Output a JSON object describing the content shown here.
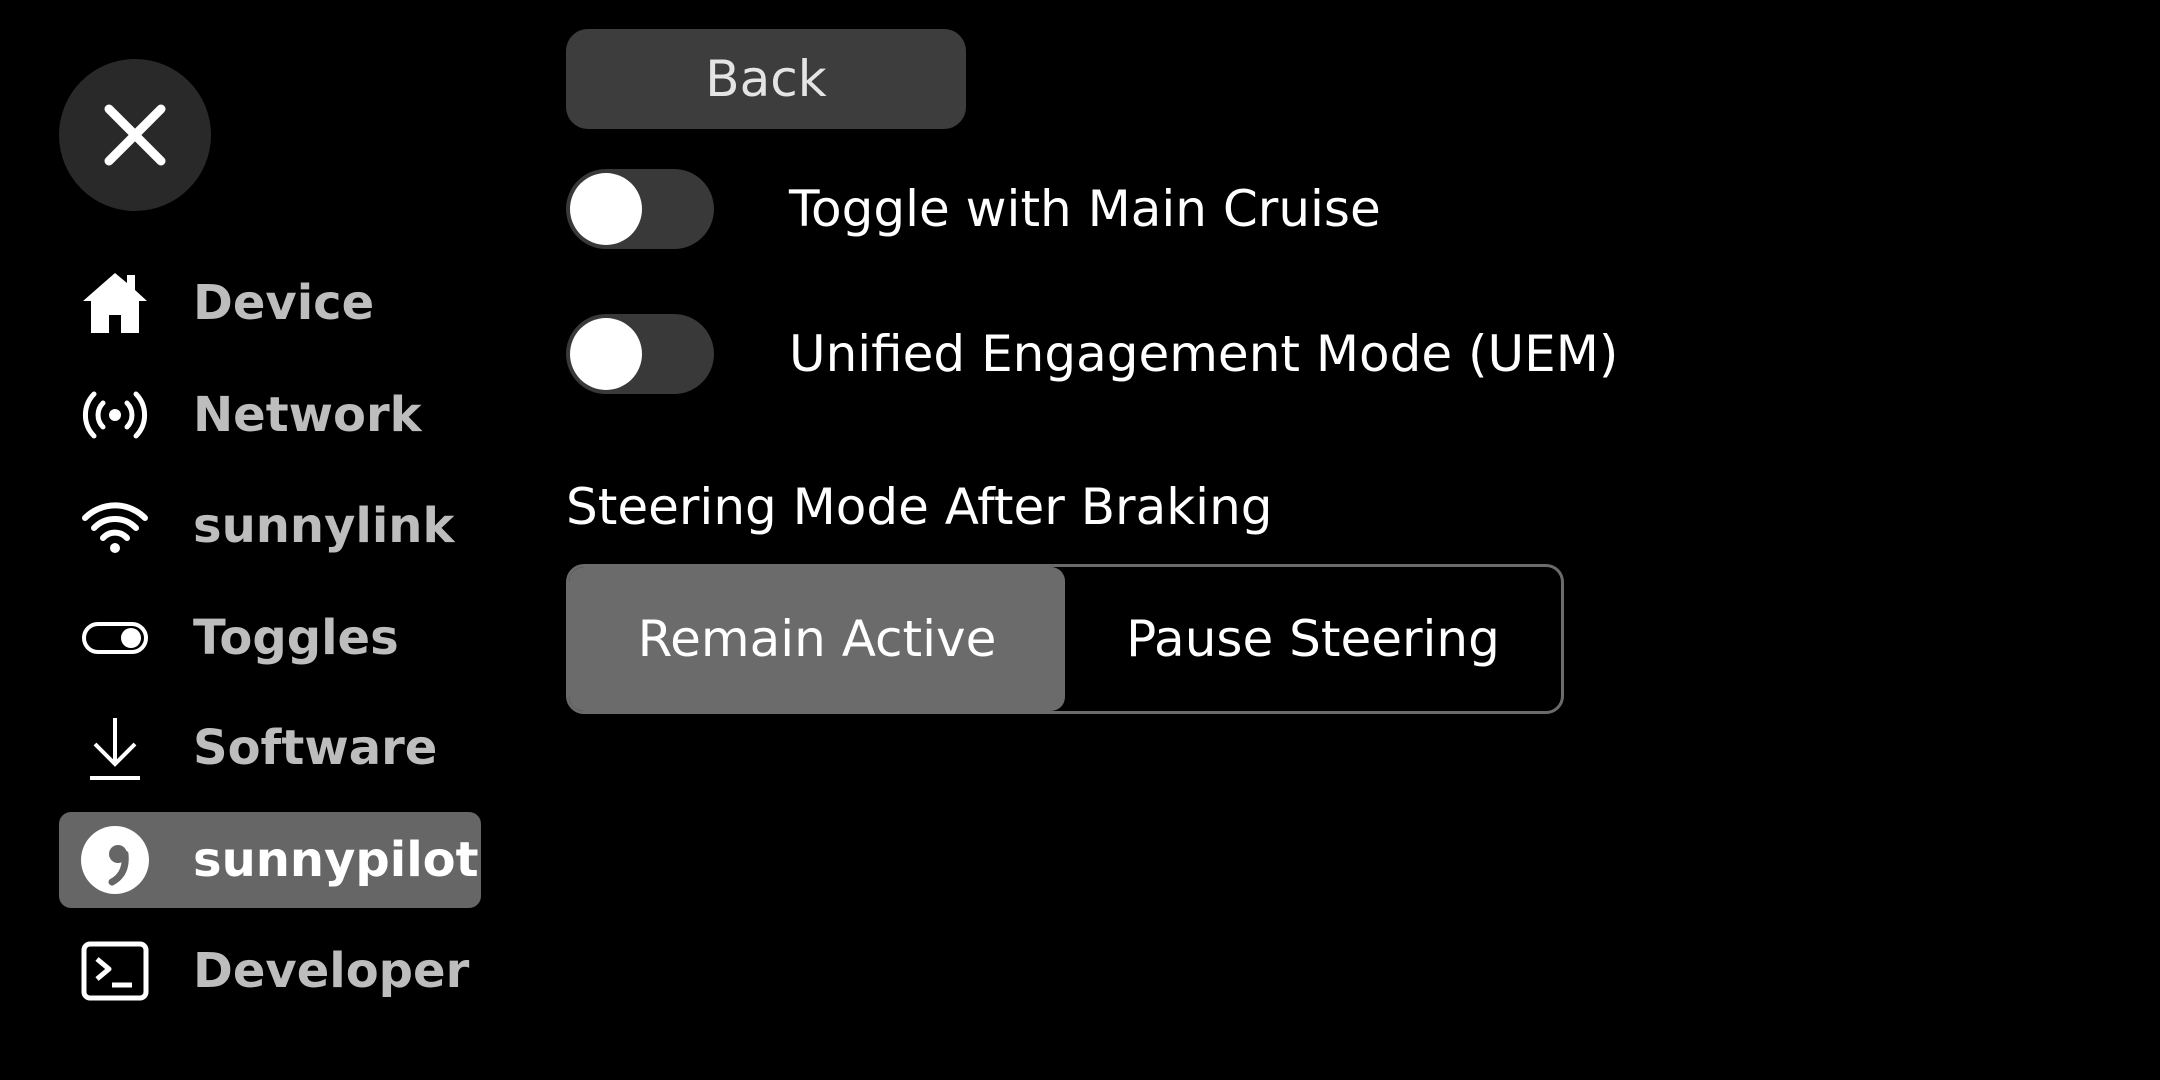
{
  "sidebar": {
    "close_icon": "close-icon",
    "items": [
      {
        "label": "Device",
        "icon": "home-icon",
        "active": false
      },
      {
        "label": "Network",
        "icon": "broadcast-icon",
        "active": false
      },
      {
        "label": "sunnylink",
        "icon": "wifi-icon",
        "active": false
      },
      {
        "label": "Toggles",
        "icon": "toggle-icon",
        "active": false
      },
      {
        "label": "Software",
        "icon": "download-icon",
        "active": false
      },
      {
        "label": "sunnypilot",
        "icon": "sunnypilot-logo-icon",
        "active": true
      },
      {
        "label": "Developer",
        "icon": "terminal-icon",
        "active": false
      }
    ],
    "active_color": "#666666",
    "text_color": "#bdbdbd"
  },
  "main": {
    "back_label": "Back",
    "toggles": [
      {
        "label": "Toggle with Main Cruise",
        "enabled": false
      },
      {
        "label": "Unified Engagement Mode (UEM)",
        "enabled": false
      }
    ],
    "steering_section": {
      "title": "Steering Mode After Braking",
      "options": [
        "Remain Active",
        "Pause Steering"
      ],
      "selected": "Remain Active"
    }
  }
}
